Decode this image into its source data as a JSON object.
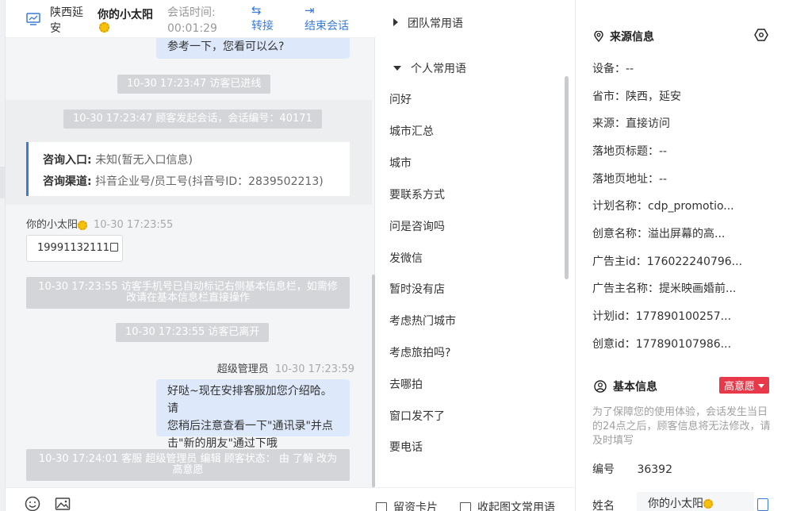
{
  "header": {
    "visitor_location": "陕西延安",
    "visitor_name": "你的小太阳",
    "timer_label": "会话时间:",
    "timer_value": "00:01:29",
    "transfer_label": "转接",
    "end_label": "结束会话"
  },
  "messages": {
    "top_bubble_tail": "参考一下，您看可以么?",
    "sys_entered": "10-30 17:23:47 访客已进线",
    "sys_started": "10-30 17:23:47 顾客发起会话，会话编号：40171",
    "card": {
      "entry_label": "咨询入口:",
      "entry_value": "未知(暂无入口信息)",
      "channel_label": "咨询渠道:",
      "channel_value": "抖音企业号/员工号(抖音号ID：2839502213)"
    },
    "visitor_sender": "你的小太阳",
    "visitor_time": "10-30 17:23:55",
    "visitor_phone": "19991132111",
    "sys_phone_line1": "10-30 17:23:55 访客手机号已自动标记右侧基本信息栏，如需修",
    "sys_phone_line2": "改请在基本信息栏直接操作",
    "sys_left": "10-30 17:23:55 访客已离开",
    "agent_sender": "超级管理员",
    "agent_time": "10-30 17:23:59",
    "agent_line1": "好哒~现在安排客服加您介绍哈。请",
    "agent_line2": "您稍后注意查看一下\"通讯录\"并点",
    "agent_line3": "击\"新的朋友\"通过下哦",
    "sys_status_line1": "10-30 17:24:01 客服 超级管理员 编辑 顾客状态： 由 了解 改为",
    "sys_status_line2": "高意愿"
  },
  "phrases": {
    "team_group": "团队常用语",
    "personal_group": "个人常用语",
    "items": [
      "问好",
      "城市汇总",
      "城市",
      "要联系方式",
      "问是咨询吗",
      "发微信",
      "暂时没有店",
      "考虑热门城市",
      "考虑旅拍吗?",
      "去哪拍",
      "窗口发不了",
      "要电话"
    ],
    "leave_card": "留资卡片",
    "collapse": "收起图文常用语"
  },
  "source_info": {
    "title": "来源信息",
    "fields": [
      "设备：--",
      "省市：陕西，延安",
      "来源：直接访问",
      "落地页标题：--",
      "落地页地址：--",
      "计划名称：cdp_promotio...",
      "创意名称：溢出屏幕的高...",
      "广告主id：176022240796...",
      "广告主名称：提米映画婚前...",
      "计划id：177890100257...",
      "创意id：177890107986..."
    ]
  },
  "basic_info": {
    "title": "基本信息",
    "badge": "高意愿",
    "notice": "为了保障您的使用体验，会话发生当日的24点之后，顾客信息将无法修改，请及时填写",
    "id_label": "编号",
    "id_value": "36392",
    "name_label": "姓名",
    "name_value": "你的小太阳"
  },
  "colors": {
    "accent": "#3a7bd5",
    "badge_red": "#e8394a",
    "agent_bubble": "#dde9fb",
    "system_gray": "#d3d5d9"
  }
}
